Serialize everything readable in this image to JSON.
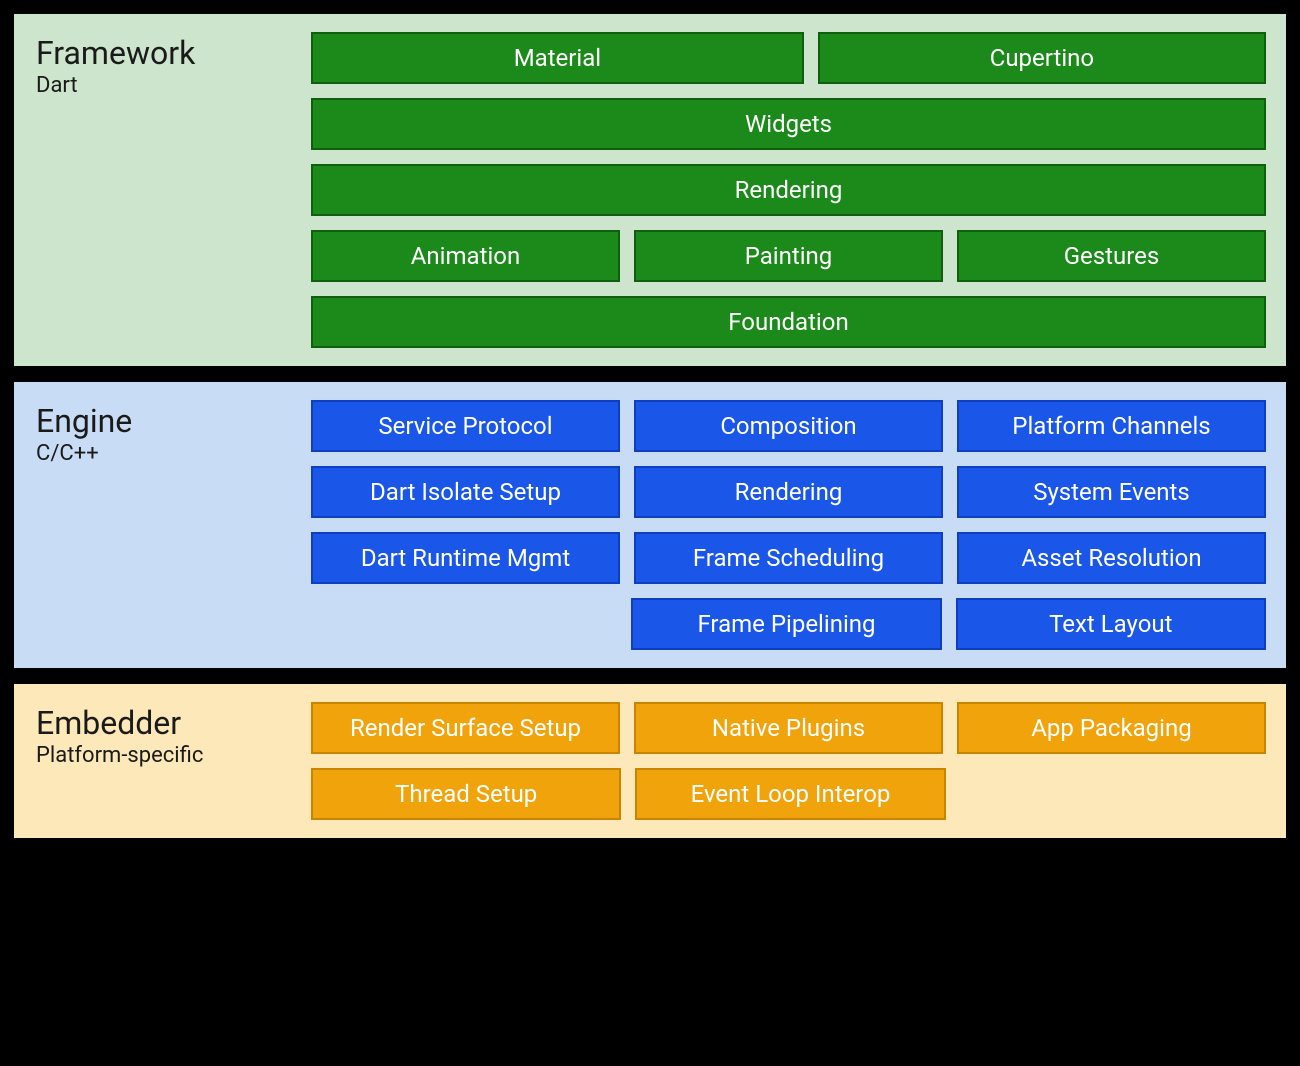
{
  "layers": {
    "framework": {
      "title": "Framework",
      "subtitle": "Dart",
      "rows": [
        {
          "items": [
            "Material",
            "Cupertino"
          ]
        },
        {
          "items": [
            "Widgets"
          ]
        },
        {
          "items": [
            "Rendering"
          ]
        },
        {
          "items": [
            "Animation",
            "Painting",
            "Gestures"
          ]
        },
        {
          "items": [
            "Foundation"
          ]
        }
      ]
    },
    "engine": {
      "title": "Engine",
      "subtitle": "C/C++",
      "rows": [
        {
          "items": [
            "Service Protocol",
            "Composition",
            "Platform Channels"
          ]
        },
        {
          "items": [
            "Dart Isolate Setup",
            "Rendering",
            "System Events"
          ]
        },
        {
          "items": [
            "Dart Runtime Mgmt",
            "Frame Scheduling",
            "Asset Resolution"
          ]
        },
        {
          "items": [
            "",
            "Frame Pipelining",
            "Text Layout"
          ]
        }
      ]
    },
    "embedder": {
      "title": "Embedder",
      "subtitle": "Platform-specific",
      "rows": [
        {
          "items": [
            "Render Surface Setup",
            "Native Plugins",
            "App Packaging"
          ]
        },
        {
          "items": [
            "Thread Setup",
            "Event Loop Interop",
            ""
          ]
        }
      ]
    }
  }
}
